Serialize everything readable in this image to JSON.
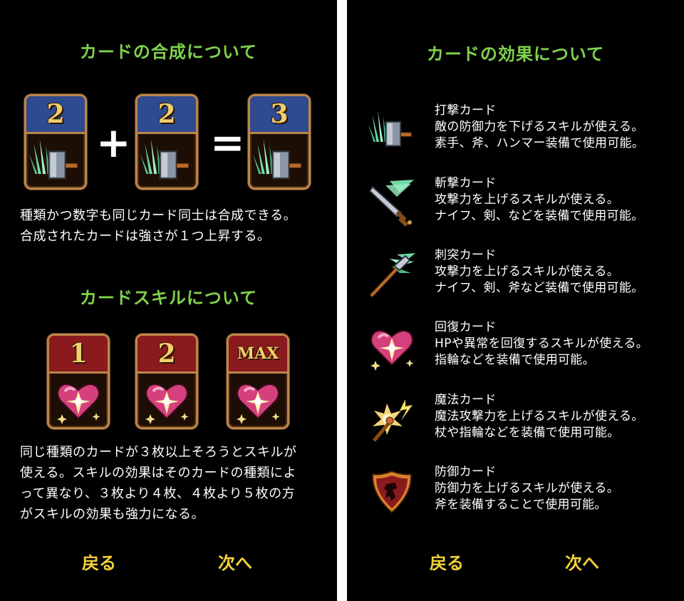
{
  "colors": {
    "heading": "#7fd34b",
    "nav": "#f3d23a",
    "text": "#ffffff",
    "card_frame": "#b9874a",
    "card_blue": "#2f4a8e",
    "card_red": "#8a1a1e"
  },
  "left": {
    "synthesis": {
      "heading": "カードの合成について",
      "card_a": "2",
      "card_b": "2",
      "card_result": "3",
      "plus": "+",
      "equals": "=",
      "text": "種類かつ数字も同じカード同士は合成できる。\n合成されたカードは強さが１つ上昇する。"
    },
    "skill": {
      "heading": "カードスキルについて",
      "card_1": "1",
      "card_2": "2",
      "card_max": "MAX",
      "text": "同じ種類のカードが３枚以上そろうとスキルが\n使える。スキルの効果はそのカードの種類によ\nって異なり、３枚より４枚、４枚より５枚の方\nがスキルの効果も強力になる。"
    },
    "nav": {
      "back": "戻る",
      "next": "次へ"
    }
  },
  "right": {
    "heading": "カードの効果について",
    "types": [
      {
        "icon": "hammer-icon",
        "name": "打撃カード",
        "line1": "敵の防御力を下げるスキルが使える。",
        "line2": "素手、斧、ハンマー装備で使用可能。"
      },
      {
        "icon": "sword-icon",
        "name": "斬撃カード",
        "line1": "攻撃力を上げるスキルが使える。",
        "line2": "ナイフ、剣、などを装備で使用可能。"
      },
      {
        "icon": "spear-icon",
        "name": "刺突カード",
        "line1": "攻撃力を上げるスキルが使える。",
        "line2": "ナイフ、剣、斧など装備で使用可能。"
      },
      {
        "icon": "heart-icon",
        "name": "回復カード",
        "line1": "HPや異常を回復するスキルが使える。",
        "line2": "指輪などを装備で使用可能。"
      },
      {
        "icon": "magic-staff-icon",
        "name": "魔法カード",
        "line1": "魔法攻撃力を上げるスキルが使える。",
        "line2": "杖や指輪などを装備で使用可能。"
      },
      {
        "icon": "shield-icon",
        "name": "防御カード",
        "line1": "防御力を上げるスキルが使える。",
        "line2": "斧を装備することで使用可能。"
      }
    ],
    "nav": {
      "back": "戻る",
      "next": "次へ"
    }
  }
}
